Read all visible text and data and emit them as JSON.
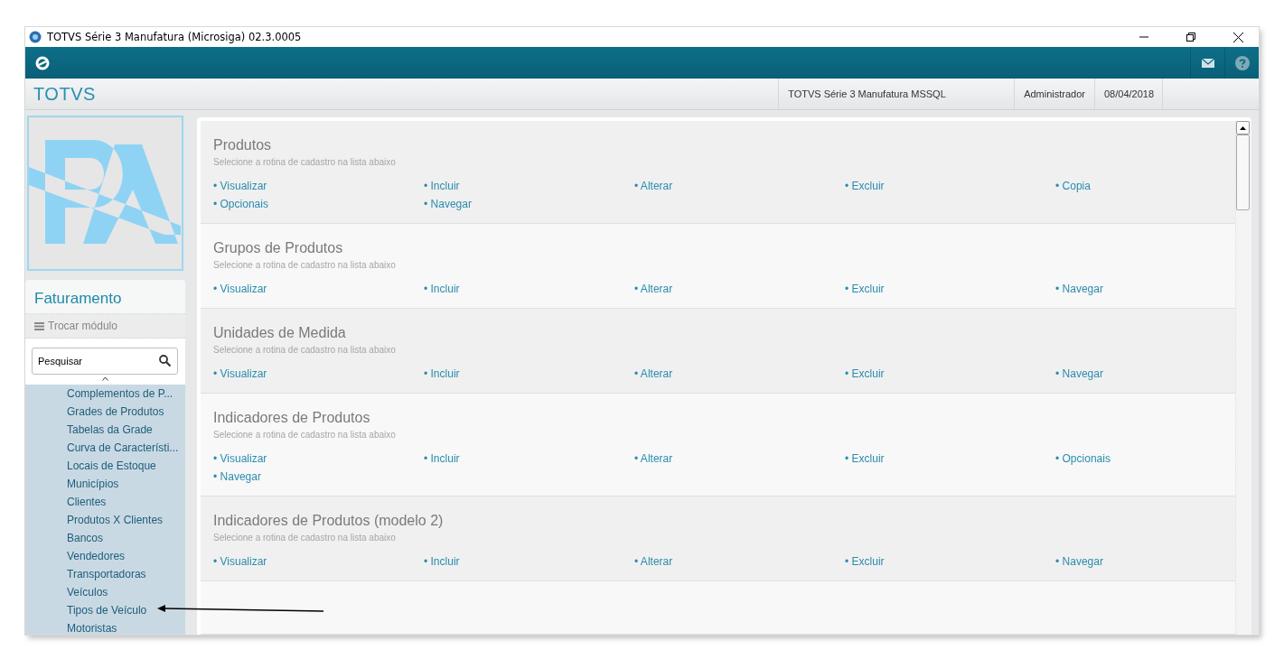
{
  "window": {
    "title": "TOTVS Série 3 Manufatura (Microsiga) 02.3.0005"
  },
  "header": {
    "brand": "TOTVS",
    "environment": "TOTVS Série 3 Manufatura MSSQL",
    "user": "Administrador",
    "date": "08/04/2018"
  },
  "sidebar": {
    "module": "Faturamento",
    "switch_module": "Trocar módulo",
    "search": {
      "placeholder": "Pesquisar"
    },
    "items": [
      {
        "label": "Complementos de P..."
      },
      {
        "label": "Grades de Produtos"
      },
      {
        "label": "Tabelas da Grade"
      },
      {
        "label": "Curva de Característi..."
      },
      {
        "label": "Locais de Estoque"
      },
      {
        "label": "Municípios"
      },
      {
        "label": "Clientes"
      },
      {
        "label": "Produtos X Clientes"
      },
      {
        "label": "Bancos"
      },
      {
        "label": "Vendedores"
      },
      {
        "label": "Transportadoras"
      },
      {
        "label": "Veículos"
      },
      {
        "label": "Tipos de Veículo"
      },
      {
        "label": "Motoristas"
      }
    ]
  },
  "sections": [
    {
      "title": "Produtos",
      "subtitle": "Selecione a rotina de cadastro na lista abaixo",
      "links": [
        "• Visualizar",
        "• Incluir",
        "• Alterar",
        "• Excluir",
        "• Copia",
        "• Opcionais",
        "• Navegar"
      ]
    },
    {
      "title": "Grupos de Produtos",
      "subtitle": "Selecione a rotina de cadastro na lista abaixo",
      "links": [
        "• Visualizar",
        "• Incluir",
        "• Alterar",
        "• Excluir",
        "• Navegar"
      ]
    },
    {
      "title": "Unidades de Medida",
      "subtitle": "Selecione a rotina de cadastro na lista abaixo",
      "links": [
        "• Visualizar",
        "• Incluir",
        "• Alterar",
        "• Excluir",
        "• Navegar"
      ]
    },
    {
      "title": "Indicadores de Produtos",
      "subtitle": "Selecione a rotina de cadastro na lista abaixo",
      "links": [
        "• Visualizar",
        "• Incluir",
        "• Alterar",
        "• Excluir",
        "• Opcionais",
        "• Navegar"
      ]
    },
    {
      "title": "Indicadores de Produtos (modelo 2)",
      "subtitle": "Selecione a rotina de cadastro na lista abaixo",
      "links": [
        "• Visualizar",
        "• Incluir",
        "• Alterar",
        "• Excluir",
        "• Navegar"
      ]
    }
  ]
}
